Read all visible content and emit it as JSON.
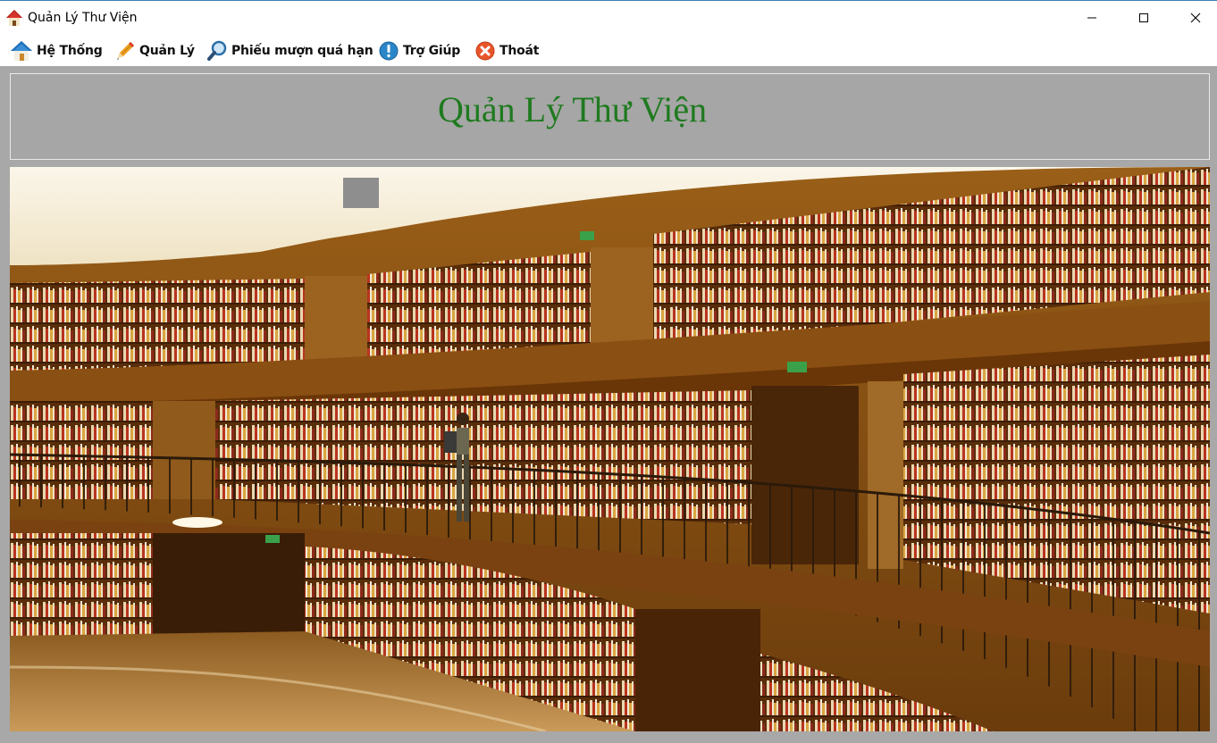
{
  "window": {
    "title": "Quản Lý Thư Viện",
    "icon": "home-icon"
  },
  "menu": {
    "items": [
      {
        "label": "Hệ Thống",
        "icon": "home-icon"
      },
      {
        "label": "Quản Lý",
        "icon": "pencil-icon"
      },
      {
        "label": "Phiếu mượn quá hạn",
        "icon": "magnifier-icon"
      },
      {
        "label": "Trợ Giúp",
        "icon": "info-icon"
      },
      {
        "label": "Thoát",
        "icon": "exit-icon"
      }
    ]
  },
  "header": {
    "title": "Quản Lý Thư Viện",
    "title_color": "#1f7a1f"
  },
  "photo": {
    "subject": "library-interior-image"
  },
  "colors": {
    "client_bg": "#a8a8a8",
    "title_green": "#1f7a1f"
  }
}
